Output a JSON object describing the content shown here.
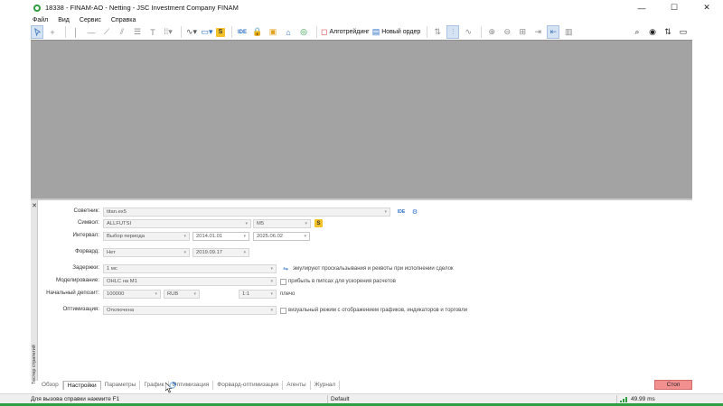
{
  "window": {
    "title": "18338 - FINAM-AO - Netting - JSC Investment Company FINAM",
    "minimize": "—",
    "maximize": "☐",
    "close": "✕"
  },
  "menu": [
    "Файл",
    "Вид",
    "Сервис",
    "Справка"
  ],
  "toolbar": {
    "algo_trading": "Алготрейдинг",
    "new_order": "Новый ордер",
    "ide_label": "IDE",
    "signals_label": "S"
  },
  "tester": {
    "side_label": "Тестер стратегий",
    "close_icon": "✕",
    "advisor_label": "Советник:",
    "advisor_value": "titan.ex5",
    "symbol_label": "Символ:",
    "symbol_value": "ALLFUTSI",
    "timeframe_value": "M5",
    "interval_label": "Интервал:",
    "interval_value": "Выбор периода",
    "date_from": "2014.01.01",
    "date_to": "2025.06.02",
    "forward_label": "Форвард:",
    "forward_value": "Нет",
    "forward_date": "2019.09.17",
    "delays_label": "Задержки:",
    "delays_value": "1 мс",
    "delays_desc": "эмулируют проскальзывания и реквоты при исполнении сделок",
    "modeling_label": "Моделирование:",
    "modeling_value": "OHLC на M1",
    "modeling_desc": "прибыль в пипсах для ускорения расчетов",
    "deposit_label": "Начальный депозит:",
    "deposit_value": "100000",
    "currency_value": "RUB",
    "leverage_value": "1:1",
    "leverage_label": "плечо",
    "optimization_label": "Оптимизация:",
    "optimization_value": "Отключена",
    "visual_desc": "визуальный режим с отображением графиков, индикаторов и торговли"
  },
  "tabs": [
    {
      "label": "Обзор",
      "active": false
    },
    {
      "label": "Настройки",
      "active": true
    },
    {
      "label": "Параметры",
      "active": false
    },
    {
      "label": "График",
      "active": false
    },
    {
      "label": "Оптимизация",
      "active": false
    },
    {
      "label": "Форвард-оптимизация",
      "active": false
    },
    {
      "label": "Агенты",
      "active": false
    },
    {
      "label": "Журнал",
      "active": false
    }
  ],
  "stop_button": "Стоп",
  "status": {
    "help": "Для вызова справки нажмите F1",
    "profile": "Default",
    "ping": "49.99 ms"
  },
  "colors": {
    "chart_bg": "#a3a3a3",
    "stop_button": "#f28f8f",
    "accent_green": "#2ea043"
  }
}
